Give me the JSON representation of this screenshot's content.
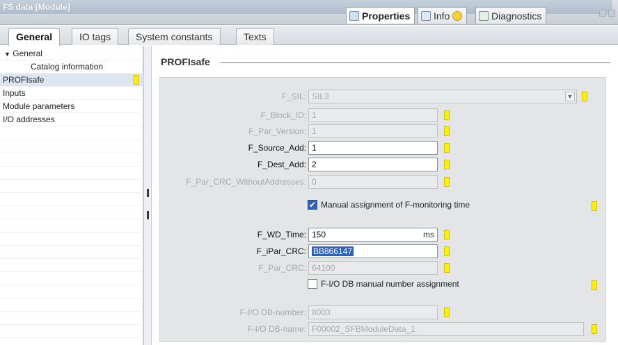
{
  "window": {
    "title": "FS data [Module]",
    "top_tabs": [
      "Properties",
      "Info",
      "Diagnostics"
    ]
  },
  "tabs": [
    "General",
    "IO tags",
    "System constants",
    "Texts"
  ],
  "nav": {
    "items": [
      {
        "label": "General"
      },
      {
        "label": "Catalog information"
      },
      {
        "label": "PROFIsafe"
      },
      {
        "label": "Inputs"
      },
      {
        "label": "Module parameters"
      },
      {
        "label": "I/O addresses"
      }
    ]
  },
  "section": {
    "title": "PROFIsafe"
  },
  "fields": {
    "f_sil": {
      "label": "F_SIL:",
      "value": "SIL3"
    },
    "f_block_id": {
      "label": "F_Block_ID:",
      "value": "1"
    },
    "f_par_version": {
      "label": "F_Par_Version:",
      "value": "1"
    },
    "f_source_add": {
      "label": "F_Source_Add:",
      "value": "1"
    },
    "f_dest_add": {
      "label": "F_Dest_Add:",
      "value": "2"
    },
    "f_par_crc_wo": {
      "label": "F_Par_CRC_WithoutAddresses:",
      "value": "0"
    },
    "manual_monitoring": {
      "label": "Manual assignment of F-monitoring time",
      "checked": true
    },
    "f_wd_time": {
      "label": "F_WD_Time:",
      "value": "150",
      "unit": "ms"
    },
    "f_ipar_crc": {
      "label": "F_iPar_CRC:",
      "value": "BB866147"
    },
    "f_par_crc": {
      "label": "F_Par_CRC:",
      "value": "64100"
    },
    "fio_db_manual": {
      "label": "F-I/O DB manual number assignment",
      "checked": false
    },
    "fio_db_number": {
      "label": "F-I/O DB-number:",
      "value": "8003"
    },
    "fio_db_name": {
      "label": "F-I/O DB-name:",
      "value": "F00002_SFBModuleData_1"
    }
  },
  "colors": {
    "accent": "#2f63b7",
    "marker": "#fff200",
    "panel": "#e4e5e7"
  }
}
